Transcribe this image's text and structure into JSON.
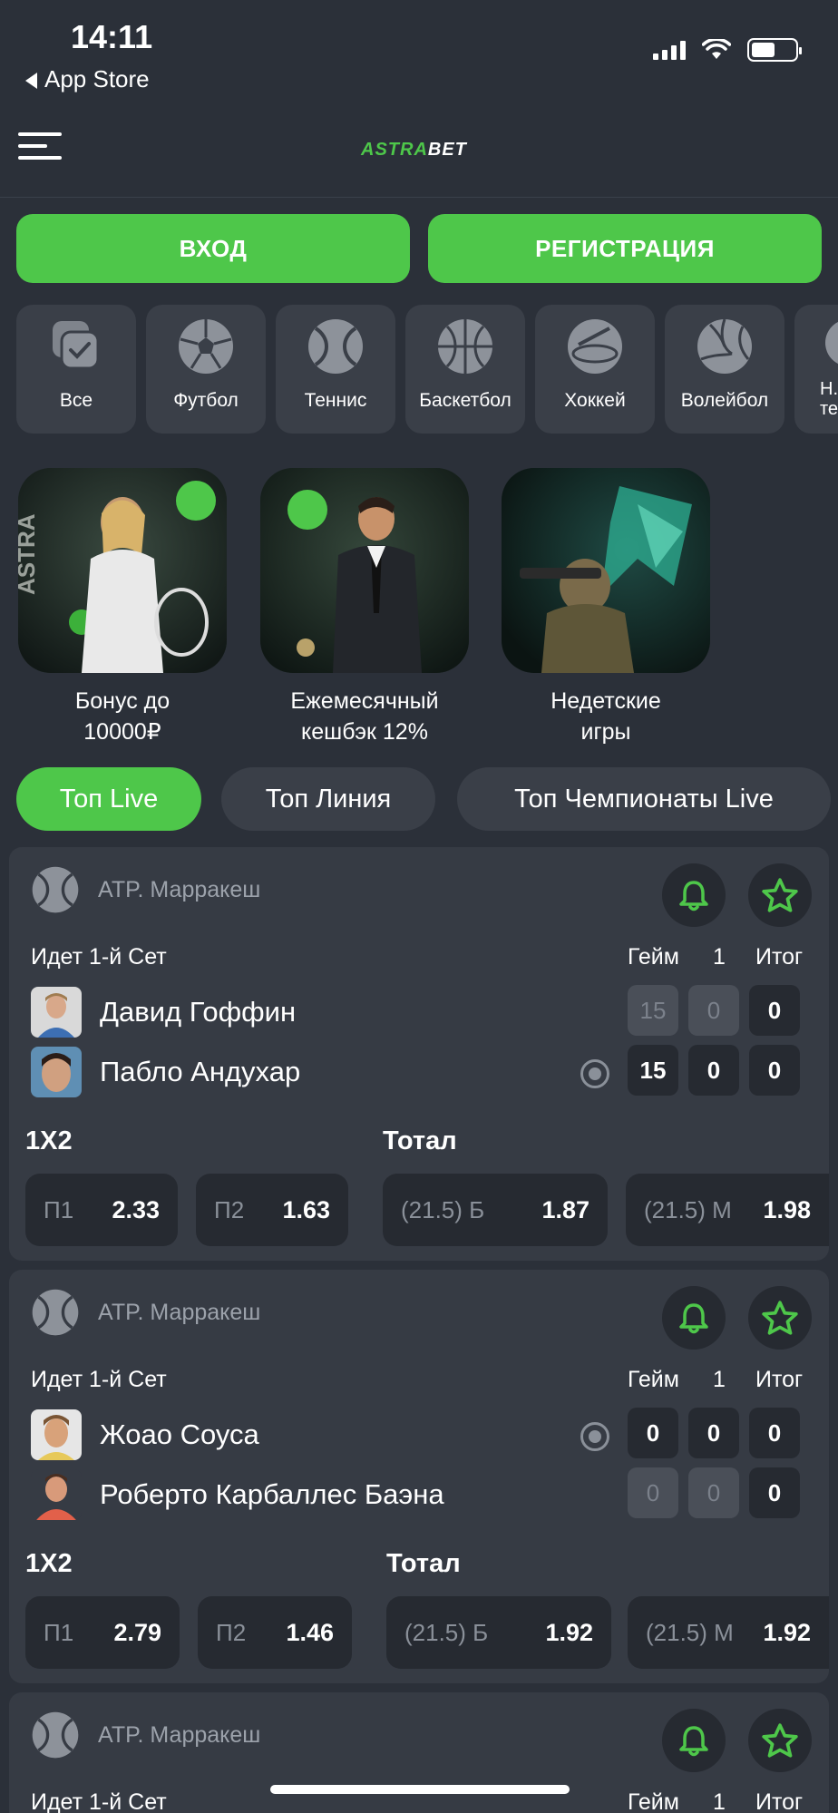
{
  "status_bar": {
    "time": "14:11",
    "back_label": "App Store"
  },
  "header": {
    "logo_part1": "ASTRA",
    "logo_part2": "BET"
  },
  "auth": {
    "login_label": "ВХОД",
    "register_label": "РЕГИСТРАЦИЯ"
  },
  "sports": [
    {
      "label": "Все",
      "icon": "all-sports-icon"
    },
    {
      "label": "Футбол",
      "icon": "soccer-ball-icon"
    },
    {
      "label": "Теннис",
      "icon": "tennis-ball-icon"
    },
    {
      "label": "Баскетбол",
      "icon": "basketball-icon"
    },
    {
      "label": "Хоккей",
      "icon": "hockey-puck-icon"
    },
    {
      "label": "Волейбол",
      "icon": "volleyball-icon"
    },
    {
      "label": "Н... те...",
      "icon": "table-tennis-icon"
    }
  ],
  "promos": [
    {
      "line1": "Бонус до",
      "line2": "10000₽"
    },
    {
      "line1": "Ежемесячный",
      "line2": "кешбэк 12%"
    },
    {
      "line1": "Недетские",
      "line2": "игры"
    }
  ],
  "tabs": [
    "Топ Live",
    "Топ Линия",
    "Топ Чемпионаты Live"
  ],
  "matches": [
    {
      "league": "ATP. Марракеш",
      "status": "Идет 1-й Сет",
      "col_game": "Гейм",
      "col_set": "1",
      "col_total": "Итог",
      "p1": {
        "name": "Давид Гоффин",
        "game": "15",
        "set": "0",
        "total": "0"
      },
      "p2": {
        "name": "Пабло Андухар",
        "game": "15",
        "set": "0",
        "total": "0"
      },
      "market1": "1X2",
      "market2": "Тотал",
      "odds": [
        {
          "k": "П1",
          "v": "2.33"
        },
        {
          "k": "П2",
          "v": "1.63"
        },
        {
          "k": "(21.5) Б",
          "v": "1.87"
        },
        {
          "k": "(21.5) М",
          "v": "1.98"
        }
      ]
    },
    {
      "league": "ATP. Марракеш",
      "status": "Идет 1-й Сет",
      "col_game": "Гейм",
      "col_set": "1",
      "col_total": "Итог",
      "p1": {
        "name": "Жоао Соуса",
        "game": "0",
        "set": "0",
        "total": "0"
      },
      "p2": {
        "name": "Роберто Карбаллес Баэна",
        "game": "0",
        "set": "0",
        "total": "0"
      },
      "market1": "1X2",
      "market2": "Тотал",
      "odds": [
        {
          "k": "П1",
          "v": "2.79"
        },
        {
          "k": "П2",
          "v": "1.46"
        },
        {
          "k": "(21.5) Б",
          "v": "1.92"
        },
        {
          "k": "(21.5) М",
          "v": "1.92"
        }
      ]
    },
    {
      "league": "ATP. Марракеш",
      "status": "Идет 1-й Сет",
      "col_game": "Гейм",
      "col_set": "1",
      "col_total": "Итог"
    }
  ],
  "colors": {
    "accent": "#4ec74a",
    "background": "#2b3039",
    "card": "#363b44",
    "chip": "#262a31"
  }
}
